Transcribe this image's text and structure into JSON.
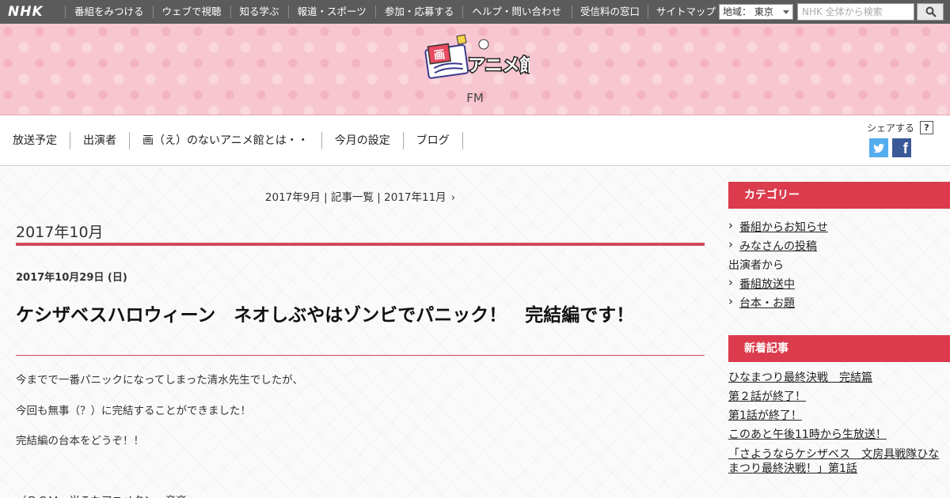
{
  "topbar": {
    "brand": "NHK",
    "nav": [
      "番組をみつける",
      "ウェブで視聴",
      "知る学ぶ",
      "報道・スポーツ",
      "参加・応募する",
      "ヘルプ・問い合わせ"
    ],
    "nav2": [
      "受信料の窓口",
      "サイトマップ"
    ],
    "region": "地域： 東京",
    "search_placeholder": "NHK 全体から検索"
  },
  "header": {
    "logo_alt": "画のないアニメ館",
    "station": "FM",
    "background_color": "#f7c6d0"
  },
  "program_nav": {
    "items": [
      "放送予定",
      "出演者",
      "画（え）のないアニメ館とは・・",
      "今月の設定",
      "ブログ"
    ],
    "share_label": "シェアする",
    "help": "?",
    "facebook_glyph": "f"
  },
  "pager": {
    "prev": "2017年9月",
    "sep1": " | ",
    "index": "記事一覧",
    "sep2": " | ",
    "next": "2017年11月",
    "chevron": "›"
  },
  "archive": {
    "month": "2017年10月"
  },
  "post": {
    "date": "2017年10月29日 (日)",
    "title": "ケシザベスハロウィーン　ネオしぶやはゾンビでパニック！　完結編です！",
    "paragraphs": [
      "今までで一番パニックになってしまった清水先生でしたが、",
      "今回も無事（？）に完結することができました！",
      "完結編の台本をどうぞ！！",
      "（ＢＧＭ　当Ｉなアニメタンー音楽"
    ]
  },
  "sidebar": {
    "category_heading": "カテゴリー",
    "categories": [
      {
        "label": "番組からお知らせ",
        "link": true
      },
      {
        "label": "みなさんの投稿",
        "link": true
      },
      {
        "label": "出演者から",
        "link": false
      },
      {
        "label": "番組放送中",
        "link": true
      },
      {
        "label": "台本・お題",
        "link": true
      }
    ],
    "news_heading": "新着記事",
    "news": [
      "ひなまつり最終決戦　完結篇",
      "第２話が終了！",
      "第1話が終了！",
      "このあと午後11時から生放送！",
      "「さようならケシザベス　文房具戦隊ひなまつり最終決戦！」第1話"
    ]
  },
  "colors": {
    "accent": "#db3b4c",
    "topbar": "#5b5b5b",
    "twitter": "#55acee",
    "facebook": "#3b5998"
  }
}
